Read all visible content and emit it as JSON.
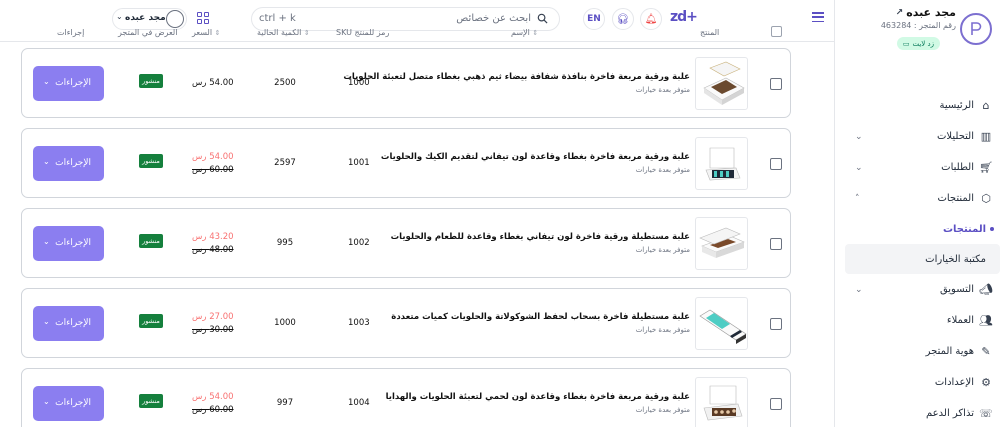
{
  "sidebar": {
    "store_name": "مجد عبده",
    "store_number": "رقم المتجر : 463284",
    "store_badge": "زد لايت",
    "nav": [
      {
        "label": "الرئيسية",
        "icon": "home-icon"
      },
      {
        "label": "التحليلات",
        "icon": "chart-icon",
        "chevron": "⌄"
      },
      {
        "label": "الطلبات",
        "icon": "cart-icon",
        "chevron": "⌄"
      },
      {
        "label": "المنتجات",
        "icon": "cube-icon",
        "chevron": "˄"
      }
    ],
    "sub": [
      "المنتجات",
      "مكتبة الخيارات"
    ],
    "nav2": [
      {
        "label": "التسويق",
        "icon": "megaphone-icon",
        "chevron": "⌄"
      },
      {
        "label": "العملاء",
        "icon": "users-icon"
      },
      {
        "label": "هوية المتجر",
        "icon": "brush-icon"
      },
      {
        "label": "الإعدادات",
        "icon": "gear-icon"
      },
      {
        "label": "تذاكر الدعم",
        "icon": "support-icon"
      }
    ]
  },
  "topbar": {
    "brand": "zd+",
    "lang": "EN",
    "search_placeholder": "ابحث عن خصائص",
    "search_shortcut": "ctrl + k",
    "user_name": "مجد عبده"
  },
  "table_header": {
    "product": "المنتج",
    "name": "الإسم",
    "sku": "رمز للمنتج SKU",
    "qty": "الكمية الحالية",
    "price": "السعر",
    "display": "العرض في المتجر",
    "actions": "إجراءات"
  },
  "rows": [
    {
      "name": "علبة ورقية مربعة فاخرة بنافذة شفافة بيضاء ثيم ذهبي بغطاء متصل لتعبئة الحلويات",
      "variants": "متوفر بعدة خيارات",
      "sku": "1000",
      "qty": "2500",
      "price": "54.00 رس",
      "status": "منشور",
      "action": "الإجراءات"
    },
    {
      "name": "علبة ورقية مربعة فاخرة بغطاء وقاعدة لون تيفاني لتقديم الكيك والحلويات",
      "variants": "متوفر بعدة خيارات",
      "sku": "1001",
      "qty": "2597",
      "sale_price": "54.00 رس",
      "old_price": "60.00 رس",
      "status": "منشور",
      "action": "الإجراءات"
    },
    {
      "name": "علبة مستطيلة ورقية فاخرة لون تيفاني بغطاء وقاعدة للطعام والحلويات",
      "variants": "متوفر بعدة خيارات",
      "sku": "1002",
      "qty": "995",
      "sale_price": "43.20 رس",
      "old_price": "48.00 رس",
      "status": "منشور",
      "action": "الإجراءات"
    },
    {
      "name": "علبة مستطيلة فاخرة بسحاب لحفظ الشوكولاتة والحلويات كميات متعددة",
      "variants": "متوفر بعدة خيارات",
      "sku": "1003",
      "qty": "1000",
      "sale_price": "27.00 رس",
      "old_price": "30.00 رس",
      "status": "منشور",
      "action": "الإجراءات"
    },
    {
      "name": "علبة ورقية مربعة فاخرة بغطاء وقاعدة لون لحمي لتعبئة الحلويات والهدايا",
      "variants": "متوفر بعدة خيارات",
      "sku": "1004",
      "qty": "997",
      "sale_price": "54.00 رس",
      "old_price": "60.00 رس",
      "status": "منشور",
      "action": "الإجراءات"
    }
  ],
  "colors": {
    "accent": "#8b7ef0",
    "brand": "#5b4fc3",
    "published": "#15803d",
    "sale": "#f87171"
  }
}
